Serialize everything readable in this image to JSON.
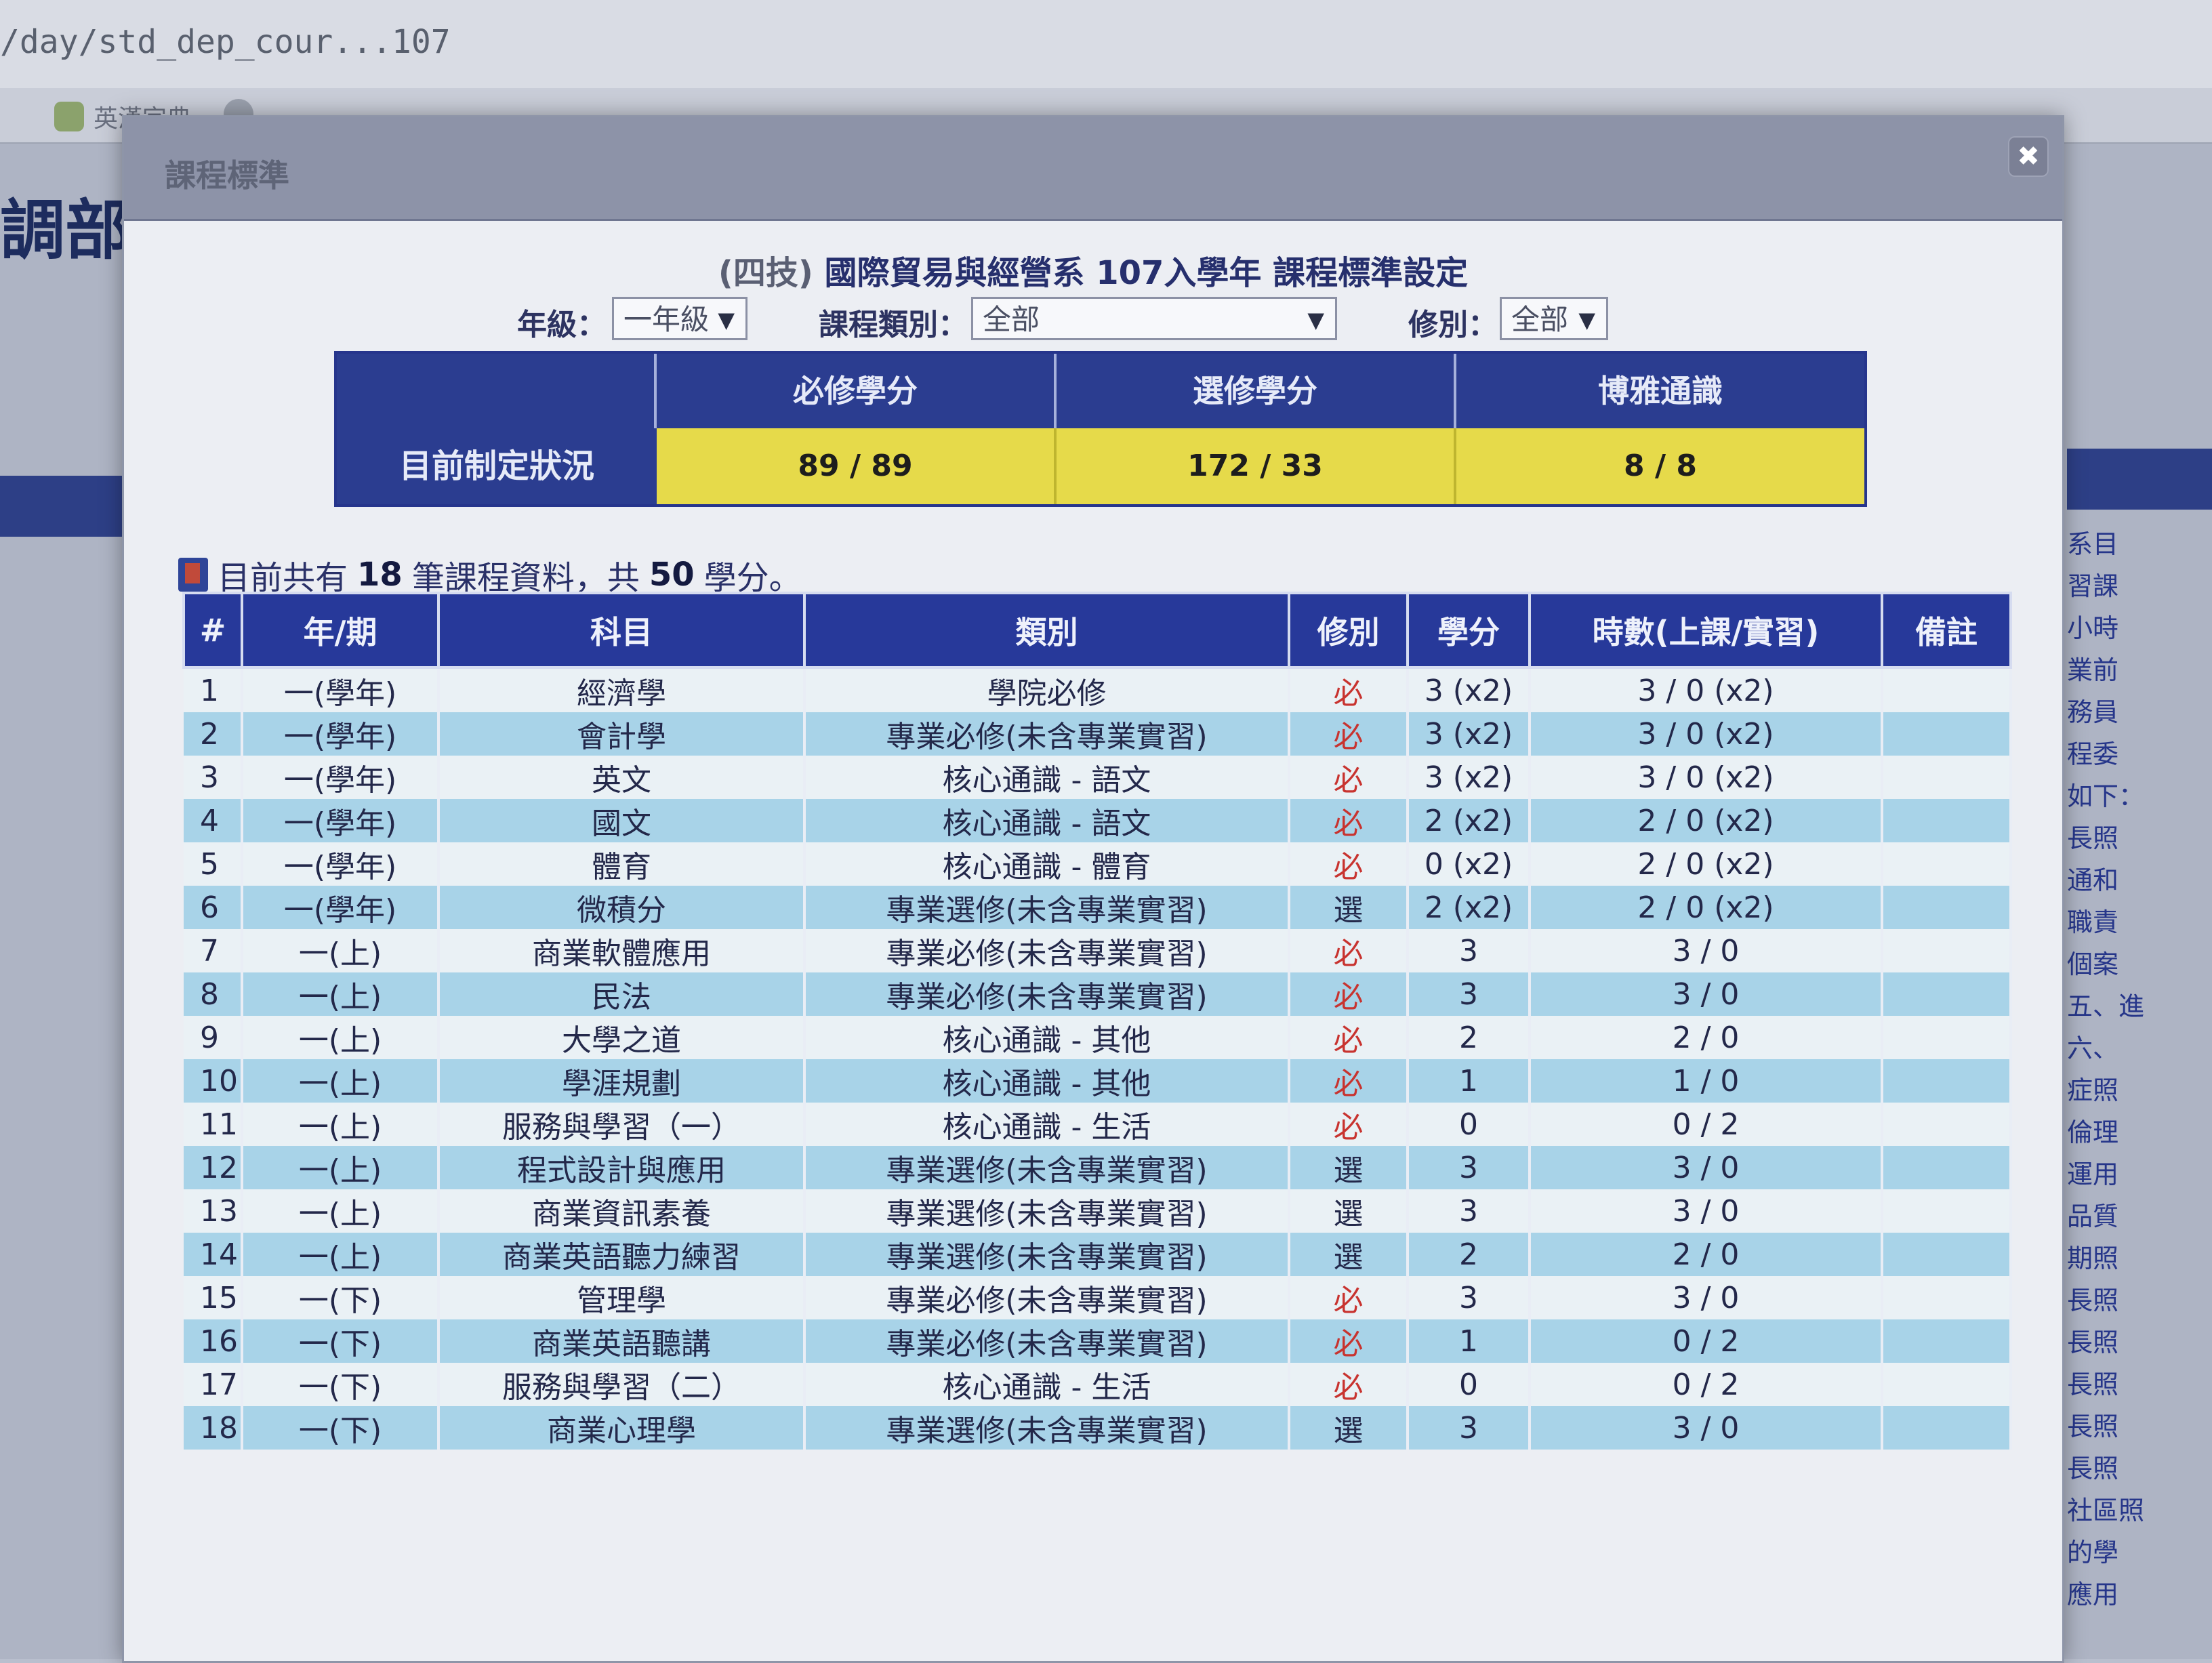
{
  "browser": {
    "address": "/day/std_dep_cour...107",
    "bookmarks": [
      "英漢字典"
    ]
  },
  "background_page": {
    "title_fragment": "調部教",
    "right_column_fragments": [
      "系目",
      "習課",
      "小時",
      "業前",
      "務員",
      "程委",
      "如下：",
      "長照",
      "通和",
      "職責",
      "個案",
      "五、進",
      "六、",
      "症照",
      "倫理",
      "運用",
      "品質",
      "期照",
      "長照",
      "長照",
      "長照",
      "長照",
      "長照",
      "社區照",
      "的學",
      "應用"
    ]
  },
  "modal": {
    "title": "課程標準",
    "close_label": "✖",
    "heading_tag": "(四技)",
    "heading": "國際貿易與經營系 107入學年 課程標準設定",
    "filters": {
      "grade_label": "年級：",
      "grade_value": "一年級",
      "category_label": "課程類別：",
      "category_value": "全部",
      "type_label": "修別：",
      "type_value": "全部"
    },
    "summary": {
      "row_label": "目前制定狀況",
      "headers": [
        "必修學分",
        "選修學分",
        "博雅通識"
      ],
      "values": [
        "89 / 89",
        "172 / 33",
        "8 / 8"
      ]
    },
    "count": {
      "prefix": "目前共有",
      "records": "18",
      "middle": "筆課程資料，共",
      "credits": "50",
      "suffix": "學分。"
    },
    "table": {
      "headers": [
        "#",
        "年/期",
        "科目",
        "類別",
        "修別",
        "學分",
        "時數(上課/實習)",
        "備註"
      ],
      "rows": [
        [
          "1",
          "一(學年)",
          "經濟學",
          "學院必修",
          "必",
          "3 (x2)",
          "3 / 0  (x2)",
          ""
        ],
        [
          "2",
          "一(學年)",
          "會計學",
          "專業必修(未含專業實習)",
          "必",
          "3 (x2)",
          "3 / 0  (x2)",
          ""
        ],
        [
          "3",
          "一(學年)",
          "英文",
          "核心通識 - 語文",
          "必",
          "3 (x2)",
          "3 / 0  (x2)",
          ""
        ],
        [
          "4",
          "一(學年)",
          "國文",
          "核心通識 - 語文",
          "必",
          "2 (x2)",
          "2 / 0  (x2)",
          ""
        ],
        [
          "5",
          "一(學年)",
          "體育",
          "核心通識 - 體育",
          "必",
          "0 (x2)",
          "2 / 0  (x2)",
          ""
        ],
        [
          "6",
          "一(學年)",
          "微積分",
          "專業選修(未含專業實習)",
          "選",
          "2 (x2)",
          "2 / 0  (x2)",
          ""
        ],
        [
          "7",
          "一(上)",
          "商業軟體應用",
          "專業必修(未含專業實習)",
          "必",
          "3",
          "3 / 0",
          ""
        ],
        [
          "8",
          "一(上)",
          "民法",
          "專業必修(未含專業實習)",
          "必",
          "3",
          "3 / 0",
          ""
        ],
        [
          "9",
          "一(上)",
          "大學之道",
          "核心通識 - 其他",
          "必",
          "2",
          "2 / 0",
          ""
        ],
        [
          "10",
          "一(上)",
          "學涯規劃",
          "核心通識 - 其他",
          "必",
          "1",
          "1 / 0",
          ""
        ],
        [
          "11",
          "一(上)",
          "服務與學習（一）",
          "核心通識 - 生活",
          "必",
          "0",
          "0 / 2",
          ""
        ],
        [
          "12",
          "一(上)",
          "程式設計與應用",
          "專業選修(未含專業實習)",
          "選",
          "3",
          "3 / 0",
          ""
        ],
        [
          "13",
          "一(上)",
          "商業資訊素養",
          "專業選修(未含專業實習)",
          "選",
          "3",
          "3 / 0",
          ""
        ],
        [
          "14",
          "一(上)",
          "商業英語聽力練習",
          "專業選修(未含專業實習)",
          "選",
          "2",
          "2 / 0",
          ""
        ],
        [
          "15",
          "一(下)",
          "管理學",
          "專業必修(未含專業實習)",
          "必",
          "3",
          "3 / 0",
          ""
        ],
        [
          "16",
          "一(下)",
          "商業英語聽講",
          "專業必修(未含專業實習)",
          "必",
          "1",
          "0 / 2",
          ""
        ],
        [
          "17",
          "一(下)",
          "服務與學習（二）",
          "核心通識 - 生活",
          "必",
          "0",
          "0 / 2",
          ""
        ],
        [
          "18",
          "一(下)",
          "商業心理學",
          "專業選修(未含專業實習)",
          "選",
          "3",
          "3 / 0",
          ""
        ]
      ]
    }
  },
  "colors": {
    "header_blue": "#27399a",
    "summary_yellow": "#e6da4a",
    "row_odd": "#eaf1f5",
    "row_even": "#a8d3e8",
    "required_red": "#c8332f"
  }
}
